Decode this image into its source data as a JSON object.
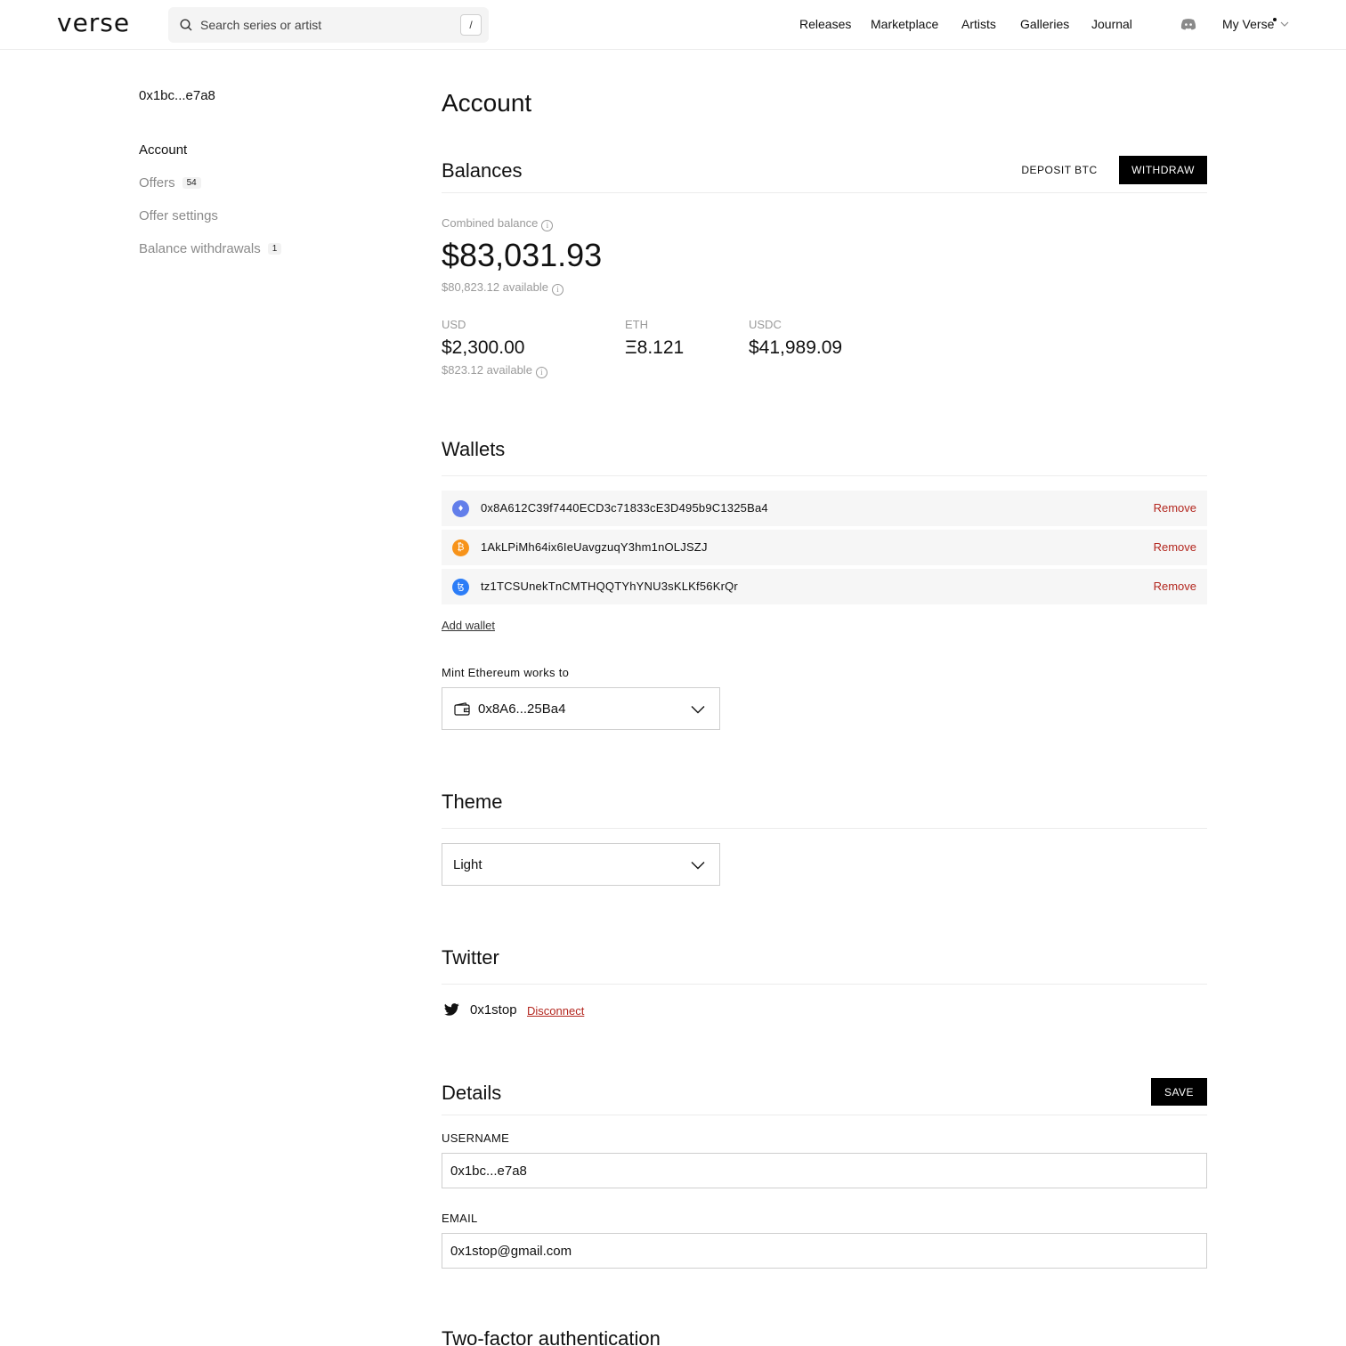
{
  "header": {
    "logo": "verse",
    "search_placeholder": "Search series or artist",
    "search_shortcut": "/",
    "nav": [
      "Releases",
      "Marketplace",
      "Artists",
      "Galleries",
      "Journal"
    ],
    "account_menu": "My Verse"
  },
  "sidebar": {
    "user": "0x1bc...e7a8",
    "items": [
      {
        "label": "Account",
        "badge": null
      },
      {
        "label": "Offers",
        "badge": "54"
      },
      {
        "label": "Offer settings",
        "badge": null
      },
      {
        "label": "Balance withdrawals",
        "badge": "1"
      }
    ]
  },
  "page": {
    "title": "Account"
  },
  "balances": {
    "heading": "Balances",
    "deposit_label": "DEPOSIT BTC",
    "withdraw_label": "WITHDRAW",
    "combined_label": "Combined balance",
    "combined_value": "$83,031.93",
    "combined_available": "$80,823.12 available",
    "currencies": [
      {
        "code": "USD",
        "value": "$2,300.00",
        "available": "$823.12 available"
      },
      {
        "code": "ETH",
        "value": "Ξ8.121",
        "available": ""
      },
      {
        "code": "USDC",
        "value": "$41,989.09",
        "available": ""
      }
    ]
  },
  "wallets": {
    "heading": "Wallets",
    "items": [
      {
        "chain": "ethereum",
        "icon": "ethereum-icon",
        "glyph": "♦",
        "color": "#627eea",
        "address": "0x8A612C39f7440ECD3c71833cE3D495b9C1325Ba4",
        "action": "Remove"
      },
      {
        "chain": "bitcoin",
        "icon": "bitcoin-icon",
        "glyph": "₿",
        "color": "#f7931a",
        "address": "1AkLPiMh64ix6IeUavgzuqY3hm1nOLJSZJ",
        "action": "Remove"
      },
      {
        "chain": "tezos",
        "icon": "tezos-icon",
        "glyph": "ꜩ",
        "color": "#2c7df7",
        "address": "tz1TCSUnekTnCMTHQQTYhYNU3sKLKf56KrQr",
        "action": "Remove"
      }
    ],
    "add_label": "Add wallet",
    "mint_label": "Mint Ethereum works to",
    "mint_value": "0x8A6...25Ba4"
  },
  "theme": {
    "heading": "Theme",
    "value": "Light"
  },
  "twitter": {
    "heading": "Twitter",
    "handle": "0x1stop",
    "disconnect_label": "Disconnect"
  },
  "details": {
    "heading": "Details",
    "save_label": "SAVE",
    "username_label": "USERNAME",
    "username_value": "0x1bc...e7a8",
    "email_label": "EMAIL",
    "email_value": "0x1stop@gmail.com"
  },
  "two_factor": {
    "heading": "Two-factor authentication"
  }
}
